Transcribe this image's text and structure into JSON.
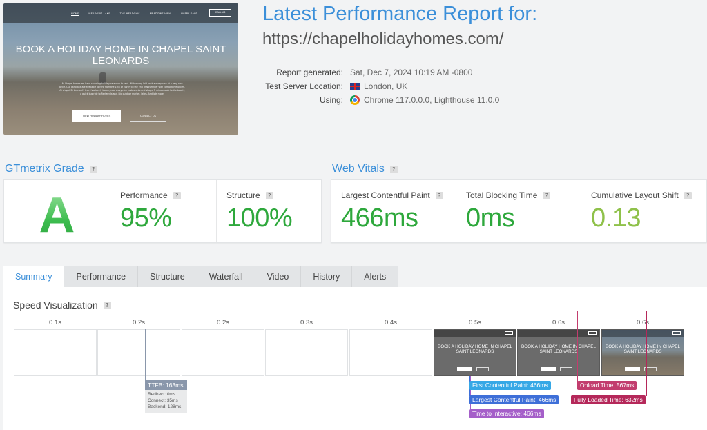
{
  "thumbnail": {
    "nav": [
      "HOME",
      "MEADOWS LAKE",
      "THE MEADOWS",
      "MEADOWS VIEW",
      "HAPPY DAYS"
    ],
    "call_label": "CALL US",
    "headline": "BOOK A HOLIDAY HOME IN CHAPEL SAINT LEONARDS",
    "body": "At Chapel homes we have stunning holiday caravans to rent. With a very laid back atmosphere at a very nice price. Our caravans are available to rent from the 15th of March till the 2nd of November with competitive prices. At chapel St Leonard's there's a lovely beach, cool crazy-nice restaurants and shops. 5 minute walk to the beach, a quick bus ride to Fantasy Island, Big outdoor market, lakes. And lots more.",
    "btn_primary": "VIEW HOLIDAY HOMES",
    "btn_secondary": "CONTACT US"
  },
  "report": {
    "title": "Latest Performance Report for:",
    "url": "https://chapelholidayhomes.com/",
    "meta": [
      {
        "label": "Report generated:",
        "value": "Sat, Dec 7, 2024 10:19 AM -0800",
        "icon": "none"
      },
      {
        "label": "Test Server Location:",
        "value": "London, UK",
        "icon": "uk-flag-icon"
      },
      {
        "label": "Using:",
        "value": "Chrome 117.0.0.0, Lighthouse 11.0.0",
        "icon": "chrome-icon"
      }
    ]
  },
  "grade": {
    "title": "GTmetrix Grade",
    "help": "?",
    "letter": "A",
    "performance_label": "Performance",
    "performance_value": "95%",
    "structure_label": "Structure",
    "structure_value": "100%"
  },
  "vitals": {
    "title": "Web Vitals",
    "help": "?",
    "items": [
      {
        "label": "Largest Contentful Paint",
        "value": "466ms",
        "color": "#2ea83c"
      },
      {
        "label": "Total Blocking Time",
        "value": "0ms",
        "color": "#2ea83c"
      },
      {
        "label": "Cumulative Layout Shift",
        "value": "0.13",
        "color": "#8fc14a"
      }
    ]
  },
  "colors": {
    "accent": "#3b8fd9",
    "good": "#2ea83c",
    "ok": "#8fc14a"
  },
  "tabs": [
    "Summary",
    "Performance",
    "Structure",
    "Waterfall",
    "Video",
    "History",
    "Alerts"
  ],
  "active_tab": "Summary",
  "speed": {
    "title": "Speed Visualization",
    "help": "?",
    "frame_times": [
      "0.1s",
      "0.2s",
      "0.2s",
      "0.3s",
      "0.4s",
      "0.5s",
      "0.6s",
      "0.6s"
    ],
    "frame_headline": "BOOK A HOLIDAY HOME IN CHAPEL SAINT LEONARDS",
    "ttfb": {
      "label": "TTFB: 163ms",
      "details": [
        "Redirect: 0ms",
        "Connect: 35ms",
        "Backend: 128ms"
      ]
    },
    "markers": {
      "fcp": {
        "label": "First Contentful Paint: 466ms",
        "color": "#36a8e6"
      },
      "lcp": {
        "label": "Largest Contentful Paint: 466ms",
        "color": "#3e6fd8"
      },
      "tti": {
        "label": "Time to Interactive: 466ms",
        "color": "#a55fc9"
      },
      "onload": {
        "label": "Onload Time: 567ms",
        "color": "#c23d6e"
      },
      "fully": {
        "label": "Fully Loaded Time: 632ms",
        "color": "#b5285a"
      }
    }
  }
}
